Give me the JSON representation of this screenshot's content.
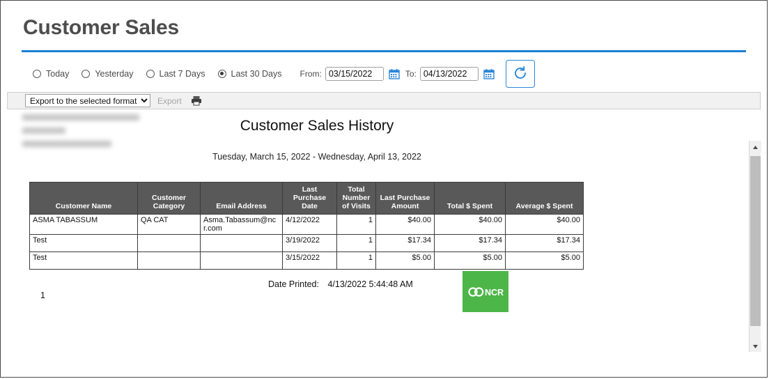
{
  "page": {
    "title": "Customer Sales",
    "accent_color": "#1b7fd4"
  },
  "filters": {
    "radios": [
      {
        "label": "Today",
        "selected": false
      },
      {
        "label": "Yesterday",
        "selected": false
      },
      {
        "label": "Last 7 Days",
        "selected": false
      },
      {
        "label": "Last 30 Days",
        "selected": true
      }
    ],
    "from_label": "From:",
    "from_value": "03/15/2022",
    "to_label": "To:",
    "to_value": "04/13/2022",
    "calendar_icon": "calendar-icon",
    "refresh_icon": "refresh-icon"
  },
  "toolbar": {
    "format_selected": "Export to the selected format",
    "format_options": [
      "Export to the selected format"
    ],
    "export_label": "Export",
    "print_icon": "printer-icon"
  },
  "report": {
    "title": "Customer Sales History",
    "subtitle": "Tuesday, March 15, 2022 - Wednesday, April 13, 2022",
    "columns": [
      "Customer Name",
      "Customer Category",
      "Email Address",
      "Last Purchase Date",
      "Total Number of Visits",
      "Last Purchase Amount",
      "Total $ Spent",
      "Average $ Spent"
    ],
    "rows": [
      {
        "name": "ASMA TABASSUM",
        "category": "QA CAT",
        "email": "Asma.Tabassum@ncr.com",
        "last_purchase_date": "4/12/2022",
        "visits": "1",
        "last_purchase_amount": "$40.00",
        "total_spent": "$40.00",
        "average_spent": "$40.00"
      },
      {
        "name": "Test",
        "category": "",
        "email": "",
        "last_purchase_date": "3/19/2022",
        "visits": "1",
        "last_purchase_amount": "$17.34",
        "total_spent": "$17.34",
        "average_spent": "$17.34"
      },
      {
        "name": "Test",
        "category": "",
        "email": "",
        "last_purchase_date": "3/15/2022",
        "visits": "1",
        "last_purchase_amount": "$5.00",
        "total_spent": "$5.00",
        "average_spent": "$5.00"
      }
    ],
    "page_number": "1",
    "date_printed_label": "Date Printed:",
    "date_printed_value": "4/13/2022 5:44:48 AM",
    "logo_text": "NCR",
    "logo_color": "#4cb648"
  }
}
